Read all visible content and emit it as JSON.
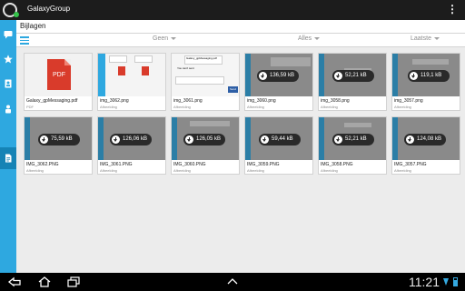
{
  "app": {
    "title": "GalaxyGroup"
  },
  "header": {
    "label": "Bijlagen"
  },
  "filters": [
    {
      "label": "Geen"
    },
    {
      "label": "Alles"
    },
    {
      "label": "Laatste"
    }
  ],
  "sidebar": {
    "items": [
      {
        "icon": "chat-icon"
      },
      {
        "icon": "star-icon"
      },
      {
        "icon": "contacts-icon"
      },
      {
        "icon": "people-icon"
      },
      {
        "icon": "attachments-icon",
        "active": true
      }
    ]
  },
  "files": [
    {
      "name": "Galaxy_gpMessaging.pdf",
      "type": "PDF"
    },
    {
      "name": "img_3062.png",
      "type": "Afbeelding"
    },
    {
      "name": "img_3061.png",
      "type": "Afbeelding"
    },
    {
      "name": "img_3060.png",
      "type": "Afbeelding",
      "size": "136,59 kB"
    },
    {
      "name": "img_3058.png",
      "type": "Afbeelding",
      "size": "52,21 kB"
    },
    {
      "name": "img_3057.png",
      "type": "Afbeelding",
      "size": "119,1 kB"
    },
    {
      "name": "IMG_3062.PNG",
      "type": "Afbeelding",
      "size": "75,59 kB"
    },
    {
      "name": "IMG_3061.PNG",
      "type": "Afbeelding",
      "size": "126,06 kB"
    },
    {
      "name": "IMG_3060.PNG",
      "type": "Afbeelding",
      "size": "126,05 kB"
    },
    {
      "name": "IMG_3059.PNG",
      "type": "Afbeelding",
      "size": "59,44 kB"
    },
    {
      "name": "IMG_3058.PNG",
      "type": "Afbeelding",
      "size": "52,21 kB"
    },
    {
      "name": "IMG_3057.PNG",
      "type": "Afbeelding",
      "size": "124,08 kB"
    }
  ],
  "preview_texts": {
    "pdf_label": "PDF",
    "chat_line_1": "You can't sent",
    "chat_line_2": "Galaxy_gpMessaging.pdf",
    "send_label": "Send"
  },
  "system": {
    "time": "11:21"
  },
  "colors": {
    "accent": "#2ea8e0",
    "pdf_red": "#d93b2b"
  }
}
